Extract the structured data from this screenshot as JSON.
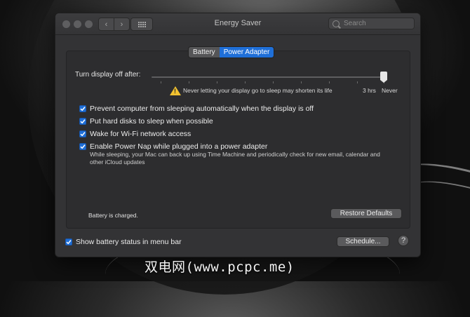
{
  "window": {
    "title": "Energy Saver"
  },
  "search": {
    "placeholder": "Search"
  },
  "tabs": [
    {
      "label": "Battery",
      "active": false
    },
    {
      "label": "Power Adapter",
      "active": true
    }
  ],
  "display_sleep": {
    "label": "Turn display off after:",
    "warning": "Never letting your display go to sleep may shorten its life",
    "tick_3hrs": "3 hrs",
    "tick_never": "Never",
    "value": "Never"
  },
  "options": [
    {
      "label": "Prevent computer from sleeping automatically when the display is off",
      "checked": true
    },
    {
      "label": "Put hard disks to sleep when possible",
      "checked": true
    },
    {
      "label": "Wake for Wi-Fi network access",
      "checked": true
    },
    {
      "label": "Enable Power Nap while plugged into a power adapter",
      "checked": true,
      "description": "While sleeping, your Mac can back up using Time Machine and periodically check for new email, calendar and other iCloud updates"
    }
  ],
  "status": {
    "battery": "Battery is charged."
  },
  "buttons": {
    "restore": "Restore Defaults",
    "schedule": "Schedule...",
    "help": "?"
  },
  "menubar_option": {
    "label": "Show battery status in menu bar",
    "checked": true
  },
  "watermark": "双电网(www.pcpc.me)",
  "colors": {
    "accent": "#1f6fd8",
    "warning": "#f2c230",
    "window_bg": "#333335"
  }
}
